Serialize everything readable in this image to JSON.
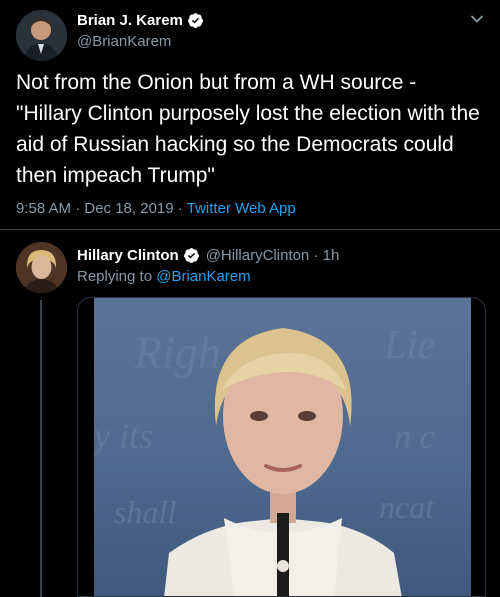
{
  "main_tweet": {
    "author_name": "Brian J. Karem",
    "author_handle": "@BrianKarem",
    "text": "Not from the Onion but from a WH source - \"Hillary Clinton purposely lost the election with the aid of Russian hacking so the Democrats could then impeach Trump\"",
    "time": "9:58 AM · Dec 18, 2019 ·",
    "app": "Twitter Web App"
  },
  "reply_tweet": {
    "author_name": "Hillary Clinton",
    "author_handle": "@HillaryClinton · 1h",
    "replying_label": "Replying to",
    "replying_mention": "@BrianKarem"
  },
  "colors": {
    "background": "#000000",
    "verified": "#ffffff",
    "link": "#1da1f2",
    "muted": "#8899a6",
    "divider": "#38444d"
  },
  "icons": {
    "verified": "verified-badge-icon",
    "more": "chevron-down-icon"
  }
}
